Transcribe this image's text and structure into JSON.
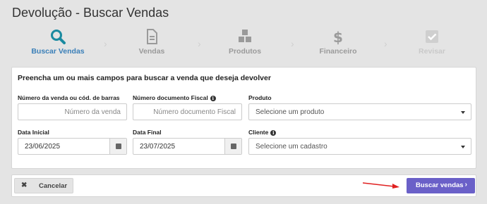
{
  "header": {
    "title": "Devolução - Buscar Vendas"
  },
  "stepper": {
    "steps": [
      {
        "label": "Buscar Vendas",
        "icon": "search-icon",
        "state": "active"
      },
      {
        "label": "Vendas",
        "icon": "document-icon",
        "state": "pending"
      },
      {
        "label": "Produtos",
        "icon": "boxes-icon",
        "state": "pending"
      },
      {
        "label": "Financeiro",
        "icon": "dollar-icon",
        "state": "pending"
      },
      {
        "label": "Revisar",
        "icon": "checkbox-icon",
        "state": "disabled"
      }
    ]
  },
  "form": {
    "title": "Preencha um ou mais campos para buscar a venda que deseja devolver",
    "numero_venda": {
      "label": "Número da venda ou cód. de barras",
      "placeholder": "Número da venda"
    },
    "numero_documento": {
      "label": "Número documento Fiscal",
      "placeholder": "Número documento Fiscal"
    },
    "produto": {
      "label": "Produto",
      "placeholder": "Selecione um produto"
    },
    "data_inicial": {
      "label": "Data Inicial",
      "value": "23/06/2025"
    },
    "data_final": {
      "label": "Data Final",
      "value": "23/07/2025"
    },
    "cliente": {
      "label": "Cliente",
      "placeholder": "Selecione um cadastro"
    }
  },
  "footer": {
    "cancel_label": "Cancelar",
    "search_label": "Buscar vendas"
  },
  "colors": {
    "accent": "#3a7fb8",
    "primary_button": "#6a60c8",
    "annotation_arrow": "#e02020"
  }
}
